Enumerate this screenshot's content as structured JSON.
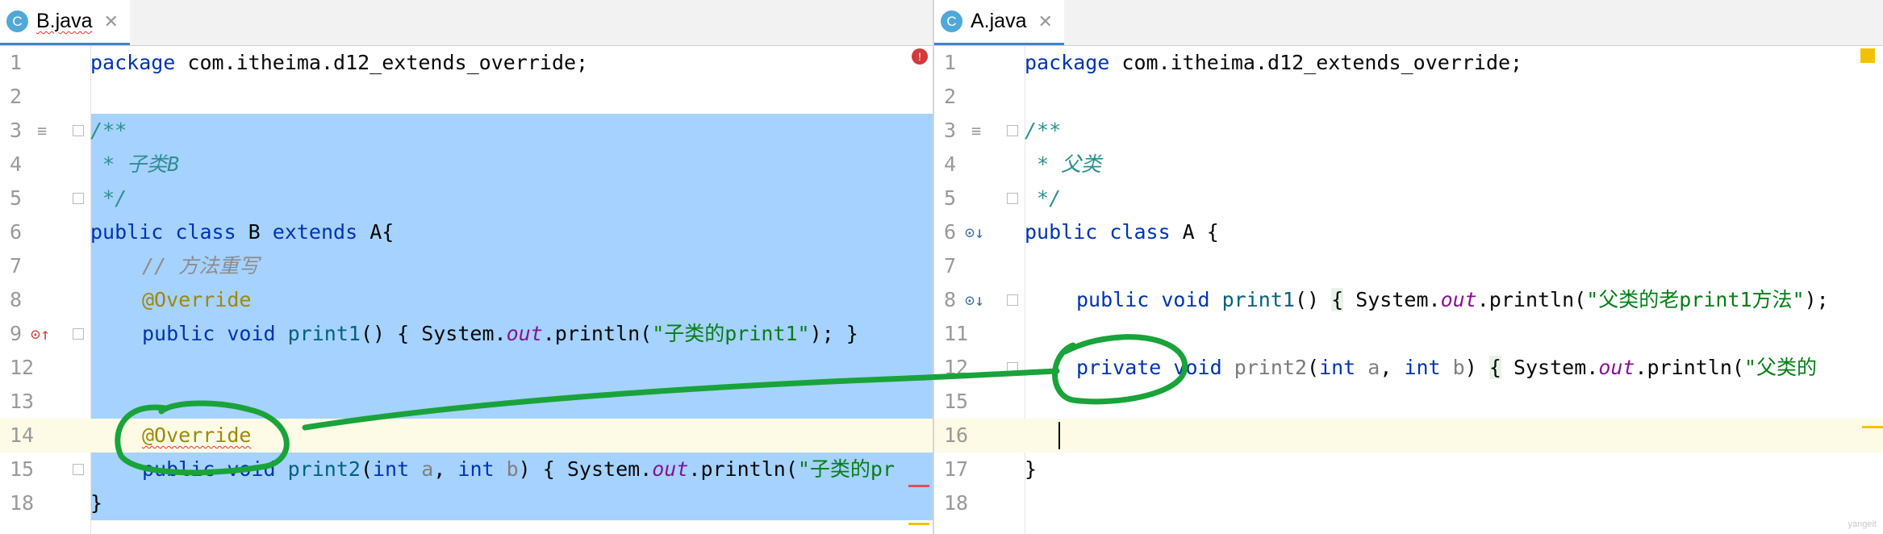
{
  "left_tab": {
    "label": "B.java",
    "icon": "c-class-icon",
    "close": "✕"
  },
  "right_tab": {
    "label": "A.java",
    "icon": "c-class-icon",
    "close": "✕"
  },
  "left_editor": {
    "lines": [
      {
        "n": "1",
        "seg": [
          [
            "kw",
            "package"
          ],
          [
            "",
            "com.itheima.d12_extends_override;"
          ]
        ]
      },
      {
        "n": "2",
        "seg": []
      },
      {
        "n": "3",
        "seg": [
          [
            "doc",
            "/**"
          ]
        ]
      },
      {
        "n": "4",
        "seg": [
          [
            "doc",
            " * 子类B"
          ]
        ]
      },
      {
        "n": "5",
        "seg": [
          [
            "doc",
            " */"
          ]
        ]
      },
      {
        "n": "6",
        "seg": [
          [
            "kw",
            "public class "
          ],
          [
            "",
            "B "
          ],
          [
            "kw",
            "extends "
          ],
          [
            "",
            "A{"
          ]
        ]
      },
      {
        "n": "7",
        "seg": [
          [
            "",
            ""
          ],
          [
            "cmt",
            "// 方法重写"
          ]
        ]
      },
      {
        "n": "8",
        "seg": [
          [
            "ann",
            "@Override"
          ]
        ]
      },
      {
        "n": "9",
        "seg": [
          [
            "kw",
            "public void "
          ],
          [
            "fn",
            "print1"
          ],
          [
            "",
            "() { System."
          ],
          [
            "st",
            "out"
          ],
          [
            "",
            ".println("
          ],
          [
            "str",
            "\"子类的print1\""
          ],
          [
            "",
            "); }"
          ]
        ]
      },
      {
        "n": "12",
        "seg": []
      },
      {
        "n": "13",
        "seg": []
      },
      {
        "n": "14",
        "seg": [
          [
            "ann squig",
            "@Override"
          ]
        ]
      },
      {
        "n": "15",
        "seg": [
          [
            "kw",
            "public void "
          ],
          [
            "fn",
            "print2"
          ],
          [
            "",
            "("
          ],
          [
            "kw",
            "int "
          ],
          [
            "prm",
            "a"
          ],
          [
            "",
            ", "
          ],
          [
            "kw",
            "int "
          ],
          [
            "prm",
            "b"
          ],
          [
            "",
            ") { System."
          ],
          [
            "st",
            "out"
          ],
          [
            "",
            ".println("
          ],
          [
            "str",
            "\"子类的pr"
          ]
        ]
      },
      {
        "n": "18",
        "seg": [
          [
            "",
            "}"
          ]
        ]
      }
    ]
  },
  "right_editor": {
    "lines": [
      {
        "n": "1",
        "seg": [
          [
            "kw",
            "package"
          ],
          [
            "",
            "com.itheima.d12_extends_override;"
          ]
        ]
      },
      {
        "n": "2",
        "seg": []
      },
      {
        "n": "3",
        "seg": [
          [
            "doc",
            "/**"
          ]
        ]
      },
      {
        "n": "4",
        "seg": [
          [
            "doc",
            " * 父类"
          ]
        ]
      },
      {
        "n": "5",
        "seg": [
          [
            "doc",
            " */"
          ]
        ]
      },
      {
        "n": "6",
        "seg": [
          [
            "kw",
            "public class "
          ],
          [
            "",
            "A {"
          ]
        ]
      },
      {
        "n": "7",
        "seg": []
      },
      {
        "n": "8",
        "seg": [
          [
            "kw",
            "public void "
          ],
          [
            "fn",
            "print1"
          ],
          [
            "",
            "() "
          ],
          [
            "fold-bg",
            "{"
          ],
          [
            "",
            " System."
          ],
          [
            "st",
            "out"
          ],
          [
            "",
            ".println("
          ],
          [
            "str",
            "\"父类的老print1方法\""
          ],
          [
            "",
            ");"
          ]
        ]
      },
      {
        "n": "11",
        "seg": []
      },
      {
        "n": "12",
        "seg": [
          [
            "kw",
            "private "
          ],
          [
            "kw",
            "void "
          ],
          [
            "gray",
            "print2"
          ],
          [
            "",
            "("
          ],
          [
            "kw",
            "int "
          ],
          [
            "prm",
            "a"
          ],
          [
            "",
            ", "
          ],
          [
            "kw",
            "int "
          ],
          [
            "prm",
            "b"
          ],
          [
            "",
            ") "
          ],
          [
            "fold-bg",
            "{"
          ],
          [
            "",
            " System."
          ],
          [
            "st",
            "out"
          ],
          [
            "",
            ".println("
          ],
          [
            "str",
            "\"父类的"
          ]
        ]
      },
      {
        "n": "15",
        "seg": []
      },
      {
        "n": "16",
        "seg": []
      },
      {
        "n": "17",
        "seg": [
          [
            "",
            "}"
          ]
        ]
      },
      {
        "n": "18",
        "seg": []
      }
    ]
  },
  "watermark": "yangeit",
  "colors": {
    "selection": "#a6d2ff",
    "annotation_pen": "#1aa33a",
    "keyword": "#0033b3"
  }
}
